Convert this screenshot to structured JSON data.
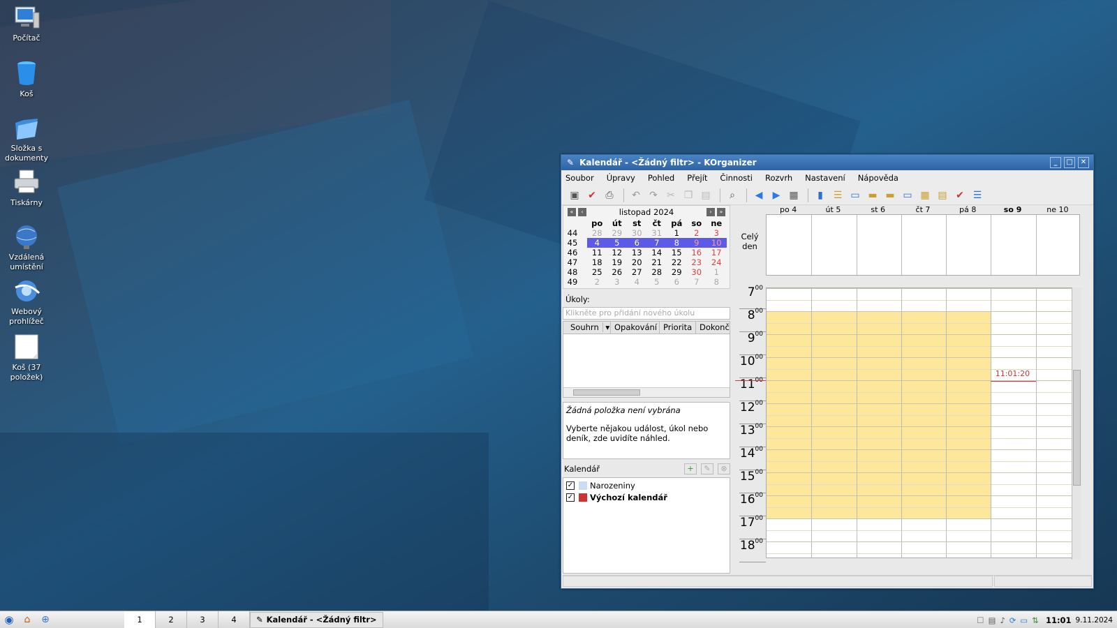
{
  "desktop": {
    "icons": [
      {
        "label": "Počítač",
        "icon": "computer-icon"
      },
      {
        "label": "Koš",
        "icon": "trash-icon"
      },
      {
        "label": "Složka s dokumenty",
        "icon": "folder-icon"
      },
      {
        "label": "Tiskárny",
        "icon": "printer-icon"
      },
      {
        "label": "Vzdálená umístění",
        "icon": "network-globe-icon"
      },
      {
        "label": "Webový prohlížeč",
        "icon": "web-browser-icon"
      },
      {
        "label": "Koš (37 položek)",
        "icon": "trash-full-icon"
      }
    ]
  },
  "window": {
    "title": "Kalendář - <Žádný filtr>  - KOrganizer",
    "menu": [
      "Soubor",
      "Úpravy",
      "Pohled",
      "Přejít",
      "Činnosti",
      "Rozvrh",
      "Nastavení",
      "Nápověda"
    ]
  },
  "minical": {
    "month": "listopad 2024",
    "weekdays": [
      "po",
      "út",
      "st",
      "čt",
      "pá",
      "so",
      "ne"
    ],
    "weeks": [
      {
        "num": "44",
        "days": [
          "28",
          "29",
          "30",
          "31",
          "1",
          "2",
          "3"
        ]
      },
      {
        "num": "45",
        "days": [
          "4",
          "5",
          "6",
          "7",
          "8",
          "9",
          "10"
        ]
      },
      {
        "num": "46",
        "days": [
          "11",
          "12",
          "13",
          "14",
          "15",
          "16",
          "17"
        ]
      },
      {
        "num": "47",
        "days": [
          "18",
          "19",
          "20",
          "21",
          "22",
          "23",
          "24"
        ]
      },
      {
        "num": "48",
        "days": [
          "25",
          "26",
          "27",
          "28",
          "29",
          "30",
          "1"
        ]
      },
      {
        "num": "49",
        "days": [
          "2",
          "3",
          "4",
          "5",
          "6",
          "7",
          "8"
        ]
      }
    ],
    "selected_week": "45",
    "colors": {
      "selected": "#5d5ae8",
      "weekend": "#e04040",
      "other_month": "#aaaaaa"
    }
  },
  "tasks": {
    "label": "Úkoly:",
    "placeholder": "Klikněte pro přidání nového úkolu",
    "columns": [
      "Souhrn",
      "Opakování",
      "Priorita",
      "Dokonč"
    ]
  },
  "preview": {
    "title": "Žádná položka není vybrána",
    "body": "Vyberte nějakou událost, úkol nebo deník, zde uvidíte náhled."
  },
  "calendars": {
    "label": "Kalendář",
    "items": [
      {
        "name": "Narozeniny",
        "color": "#c9dcf2",
        "checked": true,
        "bold": false
      },
      {
        "name": "Výchozí kalendář",
        "color": "#cc3333",
        "checked": true,
        "bold": true
      }
    ]
  },
  "agenda": {
    "days": [
      "po 4",
      "út 5",
      "st 6",
      "čt 7",
      "pá 8",
      "so 9",
      "ne 10"
    ],
    "today_index": 5,
    "allday_label": "Celý den",
    "hours": [
      "7",
      "8",
      "9",
      "10",
      "11",
      "12",
      "13",
      "14",
      "15",
      "16",
      "17",
      "18"
    ],
    "current_time": "11:01:20",
    "colors": {
      "work_hours": "#fde79b",
      "now_line": "#d43b3b"
    }
  },
  "taskbar": {
    "desktops": [
      "1",
      "2",
      "3",
      "4"
    ],
    "task_title": "Kalendář - <Žádný filtr>",
    "clock_time": "11:01",
    "clock_date": "9.11.2024"
  }
}
